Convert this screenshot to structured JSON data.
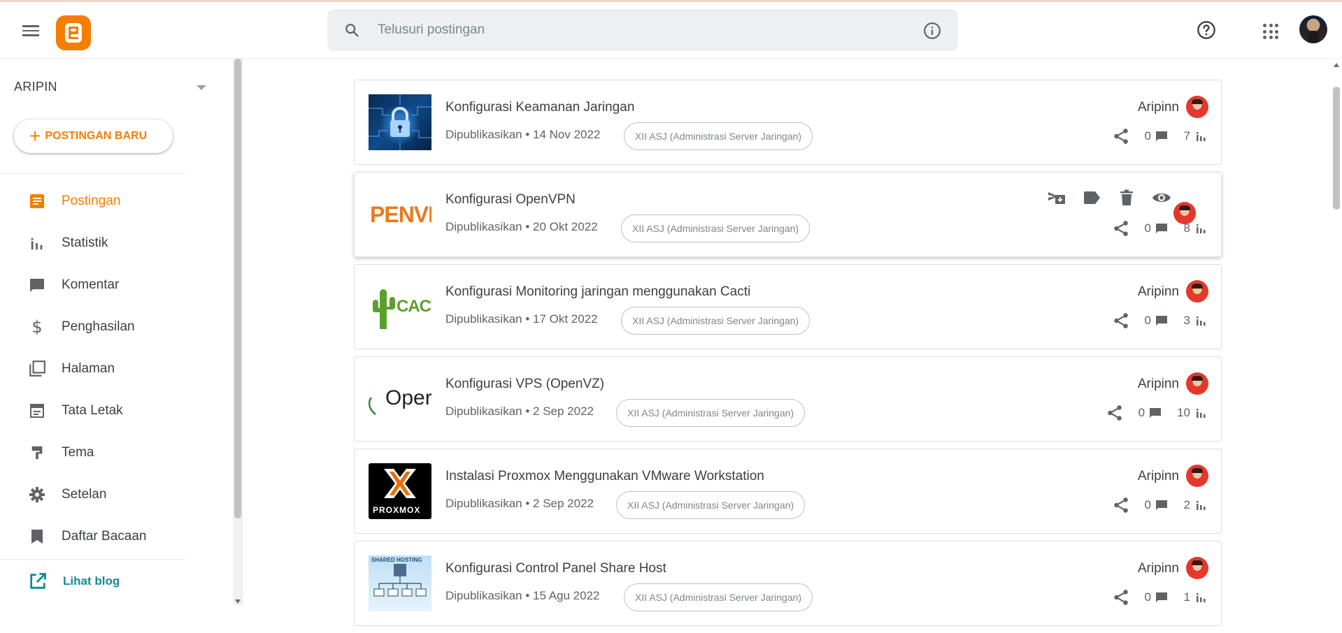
{
  "header": {
    "search_placeholder": "Telusuri postingan"
  },
  "sidebar": {
    "blog_name": "ARIPIN",
    "new_post_label": "POSTINGAN BARU",
    "items": [
      {
        "label": "Postingan",
        "icon": "posts-icon",
        "active": true
      },
      {
        "label": "Statistik",
        "icon": "stats-icon"
      },
      {
        "label": "Komentar",
        "icon": "comment-icon"
      },
      {
        "label": "Penghasilan",
        "icon": "dollar-icon"
      },
      {
        "label": "Halaman",
        "icon": "pages-icon"
      },
      {
        "label": "Tata Letak",
        "icon": "layout-icon"
      },
      {
        "label": "Tema",
        "icon": "theme-brush-icon"
      },
      {
        "label": "Setelan",
        "icon": "gear-icon"
      },
      {
        "label": "Daftar Bacaan",
        "icon": "bookmark-icon"
      }
    ],
    "view_blog_label": "Lihat blog"
  },
  "colors": {
    "brand": "#f57d00",
    "link": "#148b94",
    "text": "#3c4043"
  },
  "posts": [
    {
      "title": "Konfigurasi Keamanan Jaringan",
      "meta": "Dipublikasikan • 14 Nov 2022",
      "label": "XII ASJ (Administrasi Server Jaringan)",
      "author": "Aripinn",
      "comments": "0",
      "views": "7",
      "thumb": "security-lock"
    },
    {
      "title": "Konfigurasi OpenVPN",
      "meta": "Dipublikasikan • 20 Okt 2022",
      "label": "XII ASJ (Administrasi Server Jaringan)",
      "author": "",
      "comments": "0",
      "views": "8",
      "thumb": "openvpn-logo",
      "thumb_text": "PENVP"
    },
    {
      "title": "Konfigurasi Monitoring jaringan menggunakan Cacti",
      "meta": "Dipublikasikan • 17 Okt 2022",
      "label": "XII ASJ (Administrasi Server Jaringan)",
      "author": "Aripinn",
      "comments": "0",
      "views": "3",
      "thumb": "cacti-logo",
      "thumb_text": "CACTI"
    },
    {
      "title": "Konfigurasi VPS (OpenVZ)",
      "meta": "Dipublikasikan • 2 Sep 2022",
      "label": "XII ASJ (Administrasi Server Jaringan)",
      "author": "Aripinn",
      "comments": "0",
      "views": "10",
      "thumb": "openvz-logo",
      "thumb_text": "Oper"
    },
    {
      "title": "Instalasi Proxmox Menggunakan VMware Workstation",
      "meta": "Dipublikasikan • 2 Sep 2022",
      "label": "XII ASJ (Administrasi Server Jaringan)",
      "author": "Aripinn",
      "comments": "0",
      "views": "2",
      "thumb": "proxmox-logo",
      "thumb_text": "PROXMOX"
    },
    {
      "title": "Konfigurasi Control Panel Share Host",
      "meta": "Dipublikasikan • 15 Agu 2022",
      "label": "XII ASJ (Administrasi Server Jaringan)",
      "author": "Aripinn",
      "comments": "0",
      "views": "1",
      "thumb": "shared-hosting-diagram",
      "thumb_text": "SHARED HOSTING"
    }
  ]
}
